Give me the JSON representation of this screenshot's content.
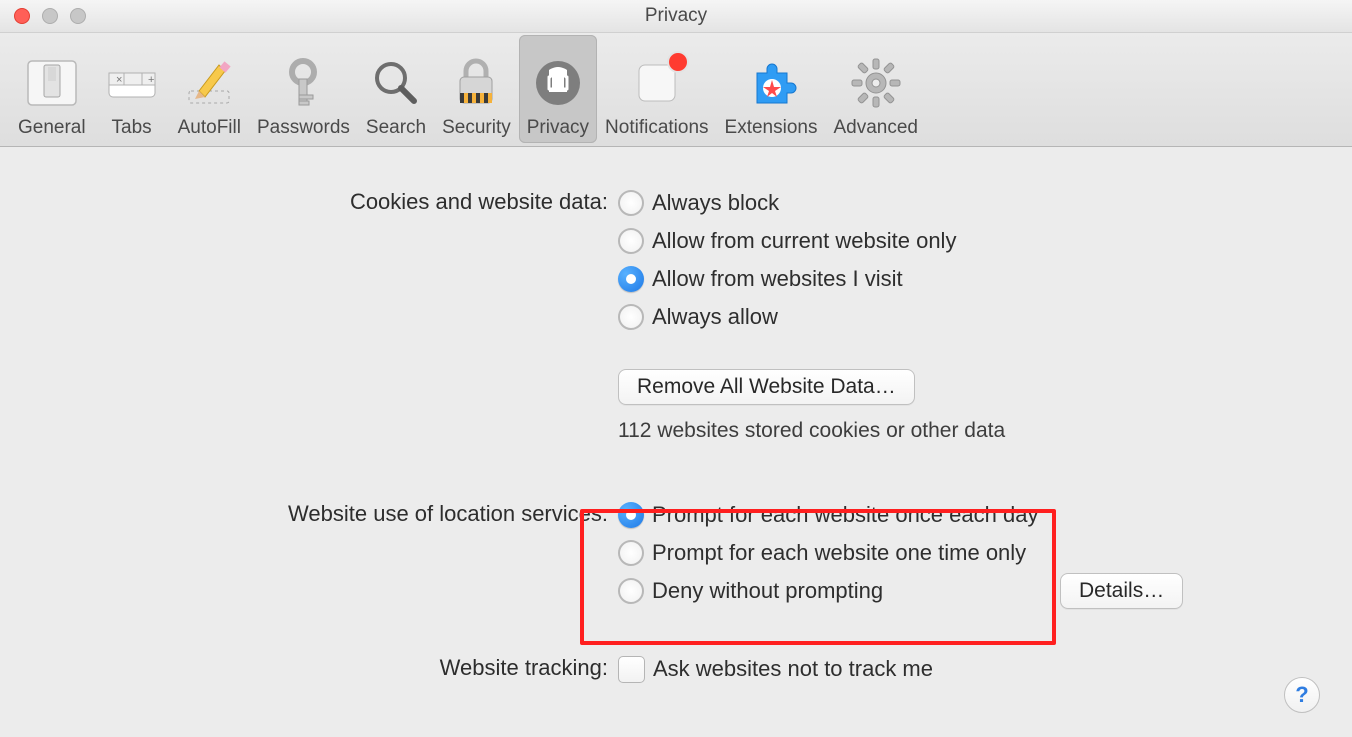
{
  "window": {
    "title": "Privacy"
  },
  "toolbar": {
    "items": [
      {
        "id": "general",
        "label": "General"
      },
      {
        "id": "tabs",
        "label": "Tabs"
      },
      {
        "id": "autofill",
        "label": "AutoFill"
      },
      {
        "id": "passwords",
        "label": "Passwords"
      },
      {
        "id": "search",
        "label": "Search"
      },
      {
        "id": "security",
        "label": "Security"
      },
      {
        "id": "privacy",
        "label": "Privacy",
        "selected": true
      },
      {
        "id": "notifications",
        "label": "Notifications",
        "badge": true
      },
      {
        "id": "extensions",
        "label": "Extensions"
      },
      {
        "id": "advanced",
        "label": "Advanced"
      }
    ]
  },
  "sections": {
    "cookies": {
      "label": "Cookies and website data:",
      "options": [
        {
          "text": "Always block",
          "checked": false
        },
        {
          "text": "Allow from current website only",
          "checked": false
        },
        {
          "text": "Allow from websites I visit",
          "checked": true
        },
        {
          "text": "Always allow",
          "checked": false
        }
      ],
      "remove_button": "Remove All Website Data…",
      "stats": "112 websites stored cookies or other data",
      "details_button": "Details…"
    },
    "location": {
      "label": "Website use of location services:",
      "options": [
        {
          "text": "Prompt for each website once each day",
          "checked": true
        },
        {
          "text": "Prompt for each website one time only",
          "checked": false
        },
        {
          "text": "Deny without prompting",
          "checked": false
        }
      ]
    },
    "tracking": {
      "label": "Website tracking:",
      "checkbox_text": "Ask websites not to track me",
      "checked": false
    }
  },
  "help_glyph": "?"
}
